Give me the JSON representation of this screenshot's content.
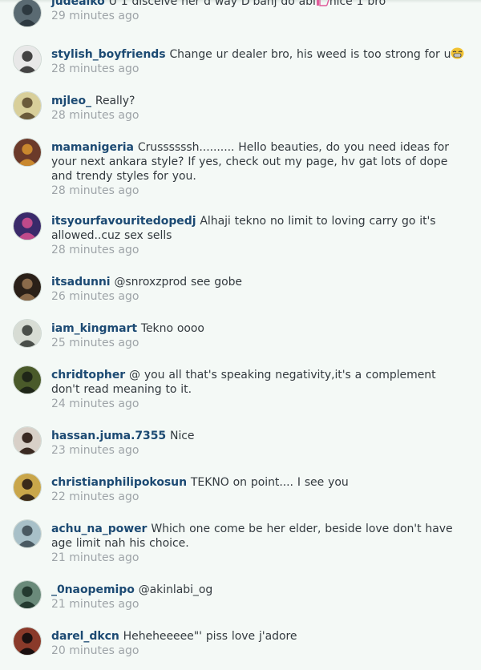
{
  "comments": [
    {
      "username": "judeaiko",
      "text_before": "U 1 disceive her d way D'banj do abi",
      "emoji": "thumbs-up-icon",
      "text_after": "nice 1 bro",
      "time": "29 minutes ago",
      "avatar_colors": [
        "#5a6a72",
        "#2d3940"
      ]
    },
    {
      "username": "stylish_boyfriends",
      "text_before": "Change ur dealer bro, his weed is too strong for u",
      "emoji": "grinning-face-icon",
      "text_after": "",
      "time": "28 minutes ago",
      "avatar_colors": [
        "#e8e8e8",
        "#444444"
      ]
    },
    {
      "username": "mjleo_",
      "text_before": "Really?",
      "emoji": "",
      "text_after": "",
      "time": "28 minutes ago",
      "avatar_colors": [
        "#d8cf9a",
        "#6a5a3a"
      ]
    },
    {
      "username": "mamanigeria",
      "text_before": "Crussssssh.......... Hello beauties, do you need ideas for your next ankara style? If yes, check out my page, hv gat lots of dope and trendy styles for you.",
      "emoji": "",
      "text_after": "",
      "time": "28 minutes ago",
      "avatar_colors": [
        "#6b3a2a",
        "#c9882e"
      ]
    },
    {
      "username": "itsyourfavouritedopedj",
      "text_before": "Alhaji tekno no limit to loving carry go it's allowed..cuz sex sells",
      "emoji": "",
      "text_after": "",
      "time": "28 minutes ago",
      "avatar_colors": [
        "#3a2a6a",
        "#c04a8a"
      ]
    },
    {
      "username": "itsadunni",
      "text_before": "@snroxzprod see gobe",
      "emoji": "",
      "text_after": "",
      "time": "26 minutes ago",
      "avatar_colors": [
        "#2a2018",
        "#8a6a4a"
      ]
    },
    {
      "username": "iam_kingmart",
      "text_before": "Tekno oooo",
      "emoji": "",
      "text_after": "",
      "time": "25 minutes ago",
      "avatar_colors": [
        "#d7dcd4",
        "#4a4f4a"
      ]
    },
    {
      "username": "chridtopher",
      "text_before": "@ you all that's speaking negativity,it's a complement don't read meaning to it.",
      "emoji": "",
      "text_after": "",
      "time": "24 minutes ago",
      "avatar_colors": [
        "#4a5a2a",
        "#1f2618"
      ]
    },
    {
      "username": "hassan.juma.7355",
      "text_before": "Nice",
      "emoji": "",
      "text_after": "",
      "time": "23 minutes ago",
      "avatar_colors": [
        "#d8d0c8",
        "#3a2a22"
      ]
    },
    {
      "username": "christianphilipokosun",
      "text_before": "TEKNO on point.... I see you",
      "emoji": "",
      "text_after": "",
      "time": "22 minutes ago",
      "avatar_colors": [
        "#c9a64a",
        "#3a2a1a"
      ]
    },
    {
      "username": "achu_na_power",
      "text_before": "Which one come be her elder, beside love don't have age limit nah his choice.",
      "emoji": "",
      "text_after": "",
      "time": "21 minutes ago",
      "avatar_colors": [
        "#a8c0c8",
        "#4a5a62"
      ]
    },
    {
      "username": "_0naopemipo",
      "text_before": "@akinlabi_og",
      "emoji": "",
      "text_after": "",
      "time": "21 minutes ago",
      "avatar_colors": [
        "#6a8a7a",
        "#243a30"
      ]
    },
    {
      "username": "darel_dkcn",
      "text_before": "Heheheeeee\"' piss love j'adore",
      "emoji": "",
      "text_after": "",
      "time": "20 minutes ago",
      "avatar_colors": [
        "#8a3a2a",
        "#1a1010"
      ]
    }
  ]
}
